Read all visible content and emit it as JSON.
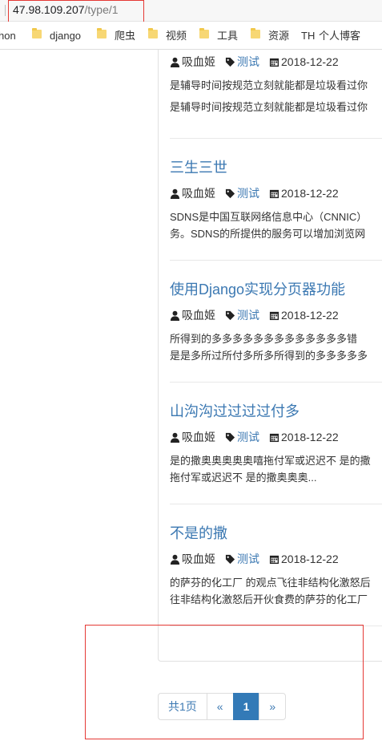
{
  "browser": {
    "url_host": "47.98.109.207",
    "url_path": "/type/1"
  },
  "bookmarks": [
    {
      "label": "hon",
      "folder": false
    },
    {
      "label": "django",
      "folder": true
    },
    {
      "label": "爬虫",
      "folder": true
    },
    {
      "label": "视频",
      "folder": true
    },
    {
      "label": "工具",
      "folder": true
    },
    {
      "label": "资源",
      "folder": true
    },
    {
      "label": "TH",
      "folder": false
    },
    {
      "label": "个人博客",
      "folder": false
    }
  ],
  "articles": [
    {
      "title": "",
      "author": "吸血姬",
      "tag": "测试",
      "date": "2018-12-22",
      "summary_lines": [
        "是辅导时间按规范立刻就能都是垃圾看过你",
        "是辅导时间按规范立刻就能都是垃圾看过你"
      ]
    },
    {
      "title": "三生三世",
      "author": "吸血姬",
      "tag": "测试",
      "date": "2018-12-22",
      "summary_lines": [
        "SDNS是中国互联网络信息中心（CNNIC）",
        "务。SDNS的所提供的服务可以增加浏览网"
      ]
    },
    {
      "title": "使用Django实现分页器功能",
      "author": "吸血姬",
      "tag": "测试",
      "date": "2018-12-22",
      "summary_lines": [
        "所得到的多多多多多多多多多多多多多错",
        "是是多所过所付多所多所得到的多多多多多"
      ]
    },
    {
      "title": "山沟沟过过过过付多",
      "author": "吸血姬",
      "tag": "测试",
      "date": "2018-12-22",
      "summary_lines": [
        "是的撒奥奥奥奥奥嘻拖付军或迟迟不 是的撒",
        "拖付军或迟迟不 是的撒奥奥奥..."
      ]
    },
    {
      "title": "不是的撒",
      "author": "吸血姬",
      "tag": "测试",
      "date": "2018-12-22",
      "summary_lines": [
        "的萨芬的化工厂 的观点飞往非结构化激怒后",
        "往非结构化激怒后开伙食费的萨芬的化工厂"
      ]
    }
  ],
  "pagination": {
    "total": "共1页",
    "prev": "«",
    "current": "1",
    "next": "»"
  },
  "colors": {
    "link": "#3b78b2",
    "active_page": "#337ab7",
    "annotation": "#e53935"
  }
}
